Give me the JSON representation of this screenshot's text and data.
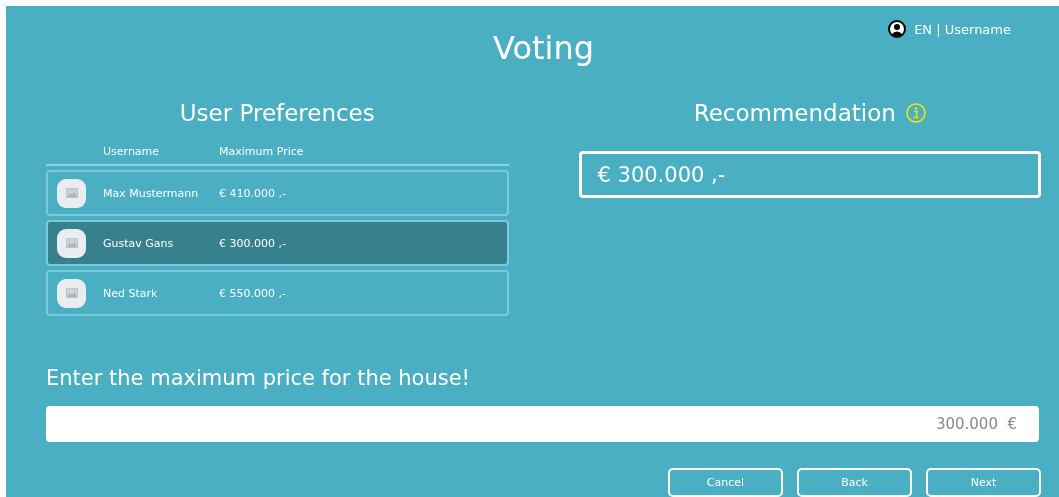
{
  "header": {
    "title": "Voting",
    "user_menu": "EN | Username"
  },
  "user_preferences": {
    "title": "User Preferences",
    "columns": [
      "Username",
      "Maximum Price"
    ],
    "rows": [
      {
        "name": "Max Mustermann",
        "price": "€ 410.000 ,-",
        "selected": false
      },
      {
        "name": "Gustav Gans",
        "price": "€ 300.000 ,-",
        "selected": true
      },
      {
        "name": "Ned Stark",
        "price": "€ 550.000 ,-",
        "selected": false
      }
    ]
  },
  "recommendation": {
    "title": "Recommendation",
    "value": "€ 300.000 ,-"
  },
  "price_entry": {
    "prompt": "Enter the maximum price for the house!",
    "value": "300.000  €"
  },
  "buttons": [
    "Cancel",
    "Back",
    "Next"
  ]
}
